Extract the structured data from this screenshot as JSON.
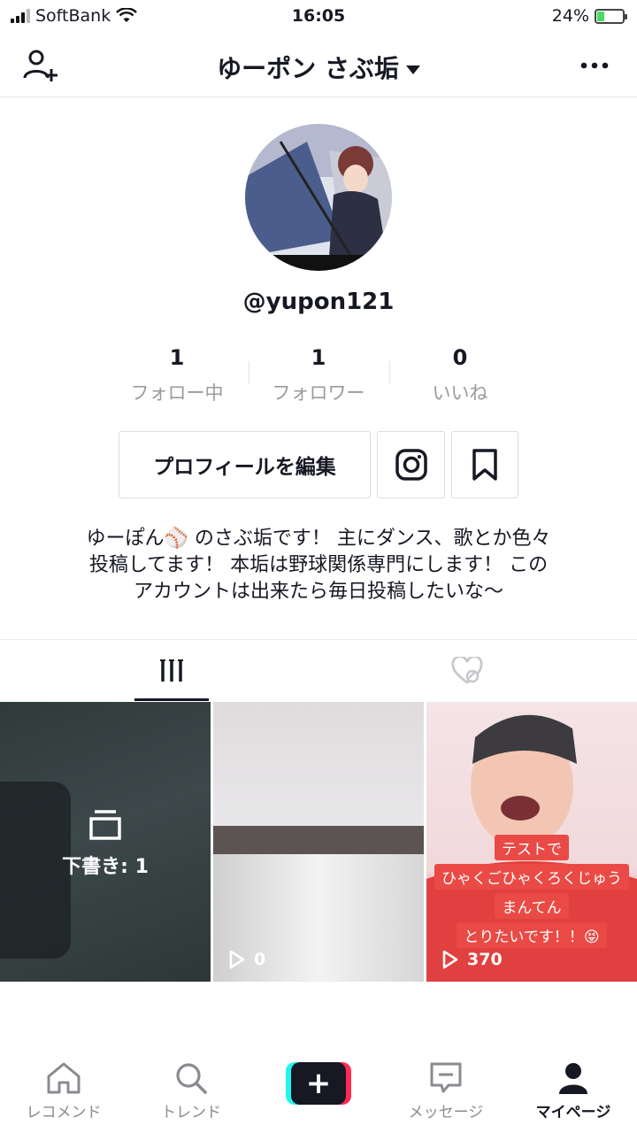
{
  "status_bar": {
    "carrier": "SoftBank",
    "time": "16:05",
    "battery": "24%"
  },
  "header": {
    "title": "ゆーポン さぶ垢",
    "add_friend_icon": "person-add-icon",
    "more_icon": "more-horizontal-icon"
  },
  "profile": {
    "username": "@yupon121",
    "stats": [
      {
        "value": "1",
        "label": "フォロー中"
      },
      {
        "value": "1",
        "label": "フォロワー"
      },
      {
        "value": "0",
        "label": "いいね"
      }
    ],
    "edit_button": "プロフィールを編集",
    "bio_lines": [
      "ゆーぽん⚾️ のさぶ垢です！ 主にダンス、歌とか色々",
      "投稿してます！ 本垢は野球関係専門にします！ この",
      "アカウントは出来たら毎日投稿したいな〜"
    ]
  },
  "tabs": [
    {
      "icon": "videos-grid-icon",
      "active": true
    },
    {
      "icon": "liked-hidden-icon",
      "active": false
    }
  ],
  "videos": [
    {
      "type": "draft",
      "label": "下書き: 1"
    },
    {
      "type": "video",
      "views": "0"
    },
    {
      "type": "video",
      "views": "370",
      "caption": [
        "テストで",
        "ひゃくごひゃくろくじゅう",
        "まんてん",
        "とりたいです！！😝"
      ]
    }
  ],
  "bottom_nav": [
    {
      "label": "レコメンド",
      "icon": "home-icon"
    },
    {
      "label": "トレンド",
      "icon": "search-icon"
    },
    {
      "label": "",
      "icon": "create-plus-icon"
    },
    {
      "label": "メッセージ",
      "icon": "message-icon"
    },
    {
      "label": "マイページ",
      "icon": "profile-icon",
      "active": true
    }
  ],
  "colors": {
    "accent_red": "#fe2c55",
    "accent_cyan": "#25f4ee",
    "text": "#161823",
    "muted": "#8a8b91"
  }
}
